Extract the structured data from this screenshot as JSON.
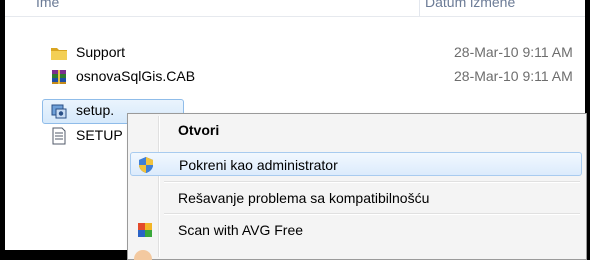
{
  "header": {
    "name_col": "Ime",
    "date_col": "Datum izmene"
  },
  "files": [
    {
      "name": "Support",
      "date": "28-Mar-10 9:11 AM",
      "icon": "folder-icon"
    },
    {
      "name": "osnovaSqlGis.CAB",
      "date": "28-Mar-10 9:11 AM",
      "icon": "cab-archive-icon"
    },
    {
      "name": "setup.",
      "date": "",
      "icon": "setup-exe-icon",
      "selected": true
    },
    {
      "name": "SETUP",
      "date": "",
      "icon": "text-file-icon"
    }
  ],
  "context_menu": {
    "items": [
      {
        "label": "Otvori",
        "bold": true
      },
      {
        "label": "Pokreni kao administrator",
        "icon": "uac-shield-icon",
        "highlighted": true
      },
      {
        "label": "Rešavanje problema sa kompatibilnošću"
      },
      {
        "label": "Scan with AVG Free",
        "icon": "avg-icon"
      }
    ]
  }
}
